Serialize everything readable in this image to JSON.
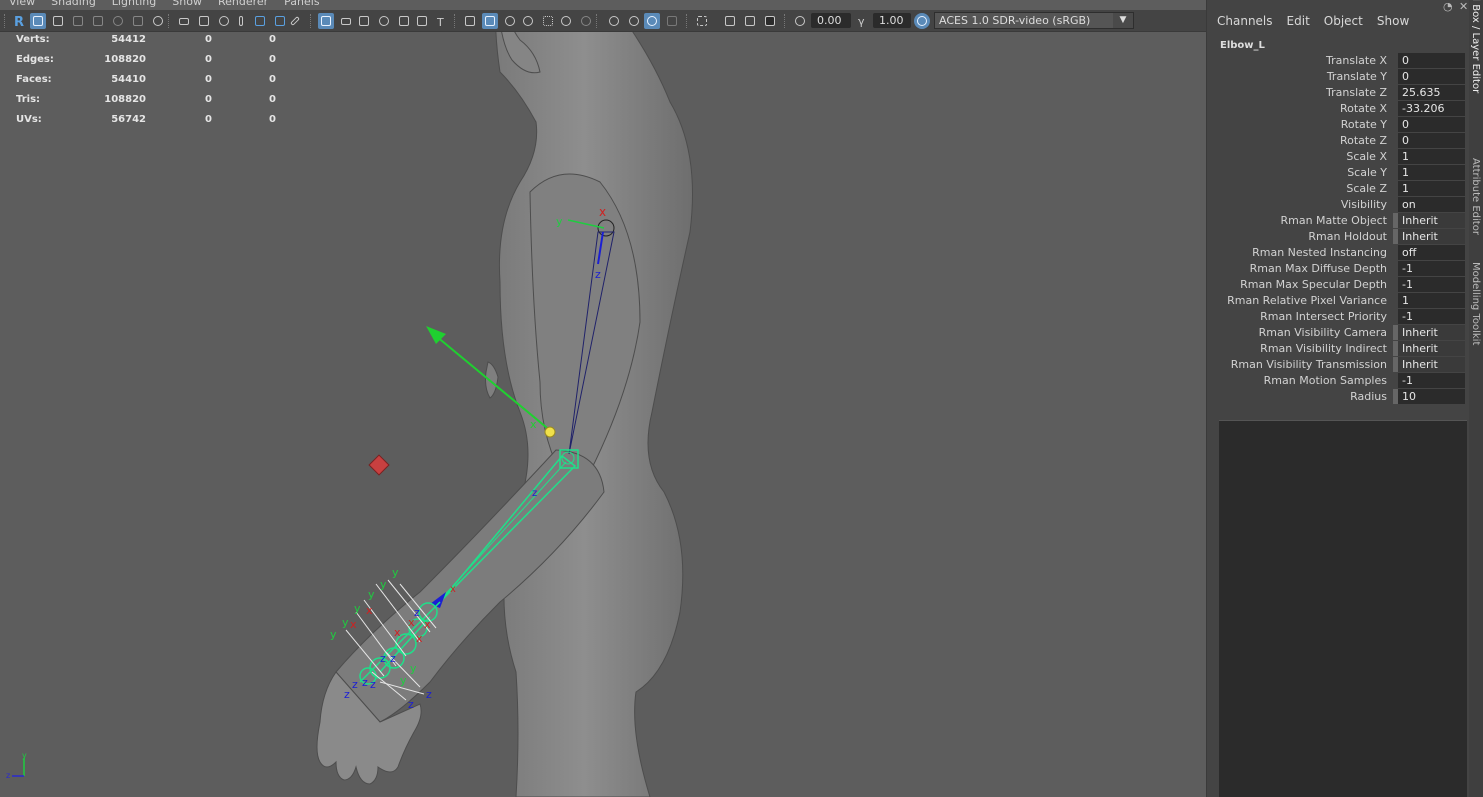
{
  "menu": [
    "View",
    "Shading",
    "Lighting",
    "Show",
    "Renderer",
    "Panels"
  ],
  "toolbar": {
    "exposure": "0.00",
    "gamma": "1.00",
    "color_space": "ACES 1.0 SDR-video (sRGB)"
  },
  "hud": {
    "rows": [
      {
        "label": "Verts:",
        "v1": "54412",
        "v2": "0",
        "v3": "0"
      },
      {
        "label": "Edges:",
        "v1": "108820",
        "v2": "0",
        "v3": "0"
      },
      {
        "label": "Faces:",
        "v1": "54410",
        "v2": "0",
        "v3": "0"
      },
      {
        "label": "Tris:",
        "v1": "108820",
        "v2": "0",
        "v3": "0"
      },
      {
        "label": "UVs:",
        "v1": "56742",
        "v2": "0",
        "v3": "0"
      }
    ]
  },
  "scene_labels": {
    "x": "x",
    "y": "y",
    "z": "z"
  },
  "channel_box": {
    "menu": [
      "Channels",
      "Edit",
      "Object",
      "Show"
    ],
    "node": "Elbow_L",
    "attributes": [
      {
        "label": "Translate X",
        "value": "0"
      },
      {
        "label": "Translate Y",
        "value": "0"
      },
      {
        "label": "Translate Z",
        "value": "25.635"
      },
      {
        "label": "Rotate X",
        "value": "-33.206"
      },
      {
        "label": "Rotate Y",
        "value": "0"
      },
      {
        "label": "Rotate Z",
        "value": "0"
      },
      {
        "label": "Scale X",
        "value": "1"
      },
      {
        "label": "Scale Y",
        "value": "1"
      },
      {
        "label": "Scale Z",
        "value": "1"
      },
      {
        "label": "Visibility",
        "value": "on"
      },
      {
        "label": "Rman Matte Object",
        "value": "Inherit"
      },
      {
        "label": "Rman Holdout",
        "value": "Inherit"
      },
      {
        "label": "Rman Nested Instancing",
        "value": "off"
      },
      {
        "label": "Rman Max Diffuse Depth",
        "value": "-1"
      },
      {
        "label": "Rman Max Specular Depth",
        "value": "-1"
      },
      {
        "label": "Rman Relative Pixel Variance",
        "value": "1"
      },
      {
        "label": "Rman Intersect Priority",
        "value": "-1"
      },
      {
        "label": "Rman Visibility Camera",
        "value": "Inherit"
      },
      {
        "label": "Rman Visibility Indirect",
        "value": "Inherit"
      },
      {
        "label": "Rman Visibility Transmission",
        "value": "Inherit"
      },
      {
        "label": "Rman Motion Samples",
        "value": "-1"
      },
      {
        "label": "Radius",
        "value": "10"
      }
    ]
  },
  "side_tabs": [
    "Channel Box / Layer Editor",
    "Attribute Editor",
    "Modelling Toolkit"
  ],
  "colors": {
    "viewport_bg": "#5d5d5d",
    "accent_blue": "#5a8ab8",
    "joint_green": "#1fe08a"
  }
}
